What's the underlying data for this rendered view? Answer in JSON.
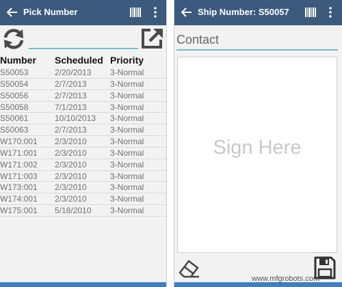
{
  "left": {
    "title": "Pick Number",
    "search": {
      "value": "",
      "placeholder": ""
    },
    "columns": [
      "Number",
      "Scheduled",
      "Priority"
    ],
    "rows": [
      [
        "S50053",
        "2/20/2013",
        "3-Normal"
      ],
      [
        "S50054",
        "2/7/2013",
        "3-Normal"
      ],
      [
        "S50056",
        "2/7/2013",
        "3-Normal"
      ],
      [
        "S50058",
        "7/1/2013",
        "3-Normal"
      ],
      [
        "S50061",
        "10/10/2013",
        "3-Normal"
      ],
      [
        "S50063",
        "2/7/2013",
        "3-Normal"
      ],
      [
        "W170:001",
        "2/3/2010",
        "3-Normal"
      ],
      [
        "W171:001",
        "2/3/2010",
        "3-Normal"
      ],
      [
        "W171:002",
        "2/3/2010",
        "3-Normal"
      ],
      [
        "W171:003",
        "2/3/2010",
        "3-Normal"
      ],
      [
        "W173:001",
        "2/3/2010",
        "3-Normal"
      ],
      [
        "W174:001",
        "2/3/2010",
        "3-Normal"
      ],
      [
        "W175:001",
        "5/18/2010",
        "3-Normal"
      ]
    ],
    "icons": [
      "back-arrow-icon",
      "barcode-icon",
      "more-vert-icon",
      "refresh-icon",
      "export-icon"
    ]
  },
  "right": {
    "title": "Ship Number: S50057",
    "contact": {
      "value": "",
      "placeholder": "Contact"
    },
    "signature_hint": "Sign Here",
    "icons": [
      "back-arrow-icon",
      "barcode-icon",
      "more-vert-icon",
      "eraser-icon",
      "save-icon"
    ]
  },
  "watermark": "www.mfgrobots.com",
  "colors": {
    "app_bar": "#3c5a7e",
    "accent": "#6ec0c8",
    "bottom_bar": "#3c7fc4"
  }
}
